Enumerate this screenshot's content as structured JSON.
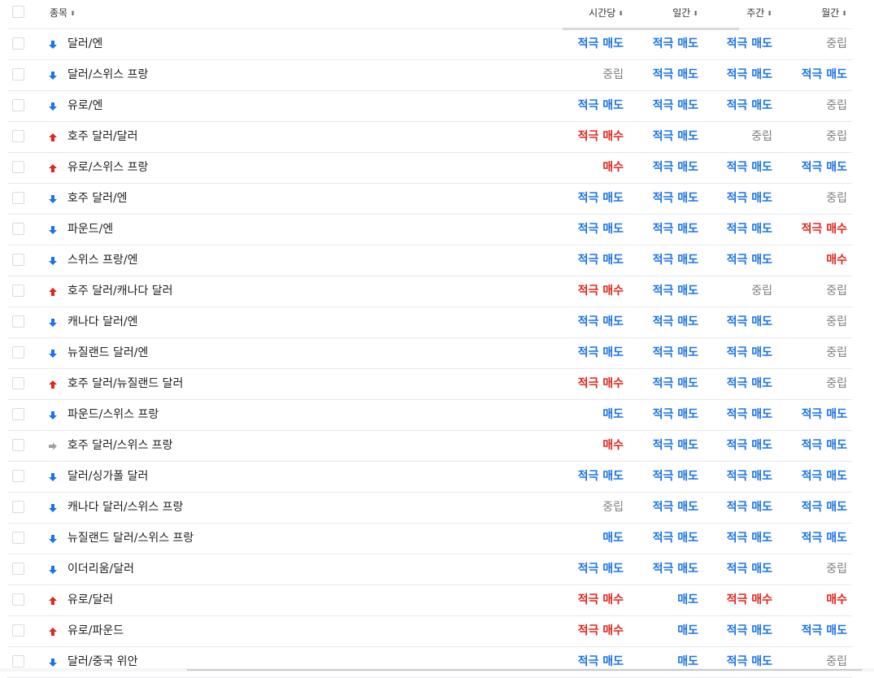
{
  "header": {
    "symbol_label": "종목",
    "col1": "시간당",
    "col2": "일간",
    "col3": "주간",
    "col4": "월간",
    "sort_glyph": "⬍"
  },
  "colors": {
    "strong_sell": "#1a73e8",
    "sell": "#1a73e8",
    "strong_buy": "#e0261c",
    "buy": "#e0261c",
    "neutral": "#808080",
    "arrow_down": "#1a73e8",
    "arrow_up": "#e0261c",
    "arrow_flat": "#a0a0a0"
  },
  "rows": [
    {
      "name": "달러/엔",
      "trend": "down",
      "signals": [
        "적극 매도",
        "적극 매도",
        "적극 매도",
        "중립"
      ]
    },
    {
      "name": "달러/스위스 프랑",
      "trend": "down",
      "signals": [
        "중립",
        "적극 매도",
        "적극 매도",
        "적극 매도"
      ]
    },
    {
      "name": "유로/엔",
      "trend": "down",
      "signals": [
        "적극 매도",
        "적극 매도",
        "적극 매도",
        "중립"
      ]
    },
    {
      "name": "호주 달러/달러",
      "trend": "up",
      "signals": [
        "적극 매수",
        "적극 매도",
        "중립",
        "중립"
      ]
    },
    {
      "name": "유로/스위스 프랑",
      "trend": "up",
      "signals": [
        "매수",
        "적극 매도",
        "적극 매도",
        "적극 매도"
      ]
    },
    {
      "name": "호주 달러/엔",
      "trend": "down",
      "signals": [
        "적극 매도",
        "적극 매도",
        "적극 매도",
        "중립"
      ]
    },
    {
      "name": "파운드/엔",
      "trend": "down",
      "signals": [
        "적극 매도",
        "적극 매도",
        "적극 매도",
        "적극 매수"
      ]
    },
    {
      "name": "스위스 프랑/엔",
      "trend": "down",
      "signals": [
        "적극 매도",
        "적극 매도",
        "적극 매도",
        "매수"
      ]
    },
    {
      "name": "호주 달러/캐나다 달러",
      "trend": "up",
      "signals": [
        "적극 매수",
        "적극 매도",
        "중립",
        "중립"
      ]
    },
    {
      "name": "캐나다 달러/엔",
      "trend": "down",
      "signals": [
        "적극 매도",
        "적극 매도",
        "적극 매도",
        "중립"
      ]
    },
    {
      "name": "뉴질랜드 달러/엔",
      "trend": "down",
      "signals": [
        "적극 매도",
        "적극 매도",
        "적극 매도",
        "중립"
      ]
    },
    {
      "name": "호주 달러/뉴질랜드 달러",
      "trend": "up",
      "signals": [
        "적극 매수",
        "적극 매도",
        "적극 매도",
        "중립"
      ]
    },
    {
      "name": "파운드/스위스 프랑",
      "trend": "down",
      "signals": [
        "매도",
        "적극 매도",
        "적극 매도",
        "적극 매도"
      ]
    },
    {
      "name": "호주 달러/스위스 프랑",
      "trend": "flat",
      "signals": [
        "매수",
        "적극 매도",
        "적극 매도",
        "적극 매도"
      ]
    },
    {
      "name": "달러/싱가폴 달러",
      "trend": "down",
      "signals": [
        "적극 매도",
        "적극 매도",
        "적극 매도",
        "적극 매도"
      ]
    },
    {
      "name": "캐나다 달러/스위스 프랑",
      "trend": "down",
      "signals": [
        "중립",
        "적극 매도",
        "적극 매도",
        "적극 매도"
      ]
    },
    {
      "name": "뉴질랜드 달러/스위스 프랑",
      "trend": "down",
      "signals": [
        "매도",
        "적극 매도",
        "적극 매도",
        "적극 매도"
      ]
    },
    {
      "name": "이더리움/달러",
      "trend": "down",
      "signals": [
        "적극 매도",
        "적극 매도",
        "적극 매도",
        "중립"
      ]
    },
    {
      "name": "유로/달러",
      "trend": "up",
      "signals": [
        "적극 매수",
        "매도",
        "적극 매수",
        "매수"
      ]
    },
    {
      "name": "유로/파운드",
      "trend": "up",
      "signals": [
        "적극 매수",
        "매도",
        "적극 매도",
        "적극 매도"
      ]
    },
    {
      "name": "달러/중국 위안",
      "trend": "down",
      "signals": [
        "적극 매도",
        "매도",
        "적극 매도",
        "중립"
      ]
    }
  ]
}
